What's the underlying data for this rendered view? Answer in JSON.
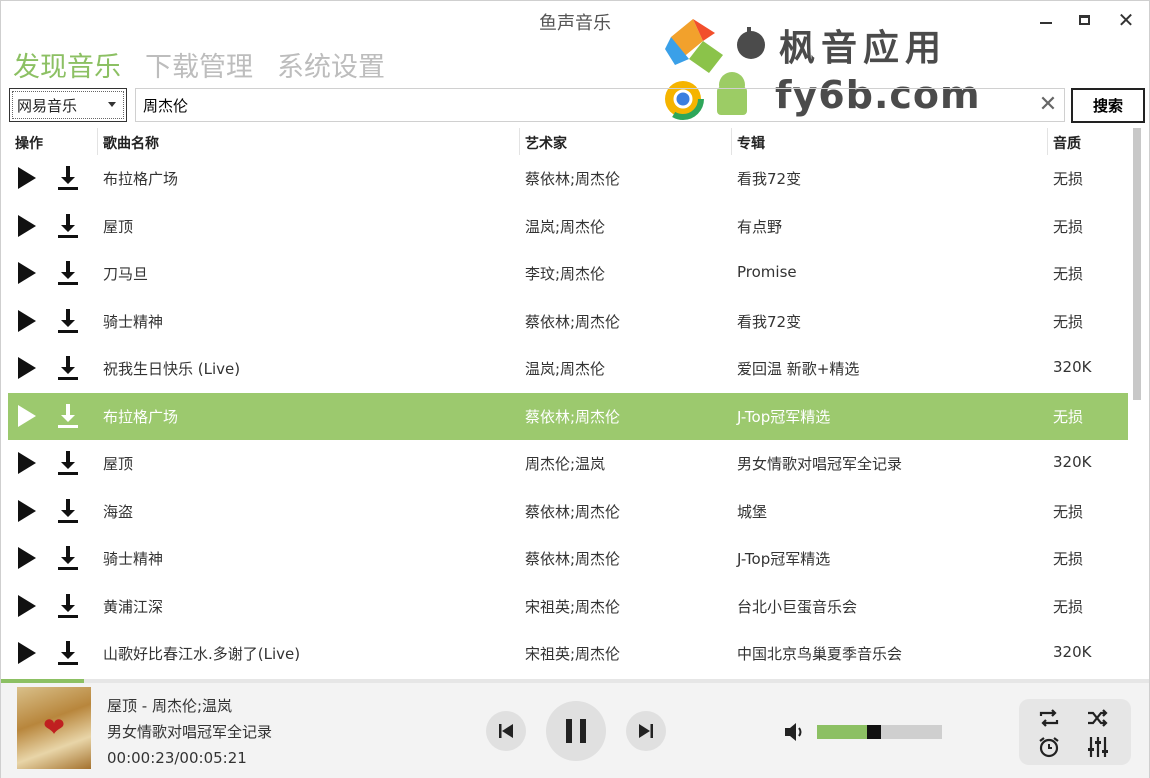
{
  "app": {
    "title": "鱼声音乐"
  },
  "nav": {
    "tabs": [
      {
        "label": "发现音乐",
        "active": true
      },
      {
        "label": "下载管理",
        "active": false
      },
      {
        "label": "系统设置",
        "active": false
      }
    ]
  },
  "watermark": {
    "line1": "枫音应用",
    "line2": "fy6b.com"
  },
  "search": {
    "source": "网易音乐",
    "query": "周杰伦",
    "button_label": "搜索"
  },
  "table": {
    "columns": [
      "操作",
      "歌曲名称",
      "艺术家",
      "专辑",
      "音质"
    ],
    "selected_index": 5,
    "rows": [
      {
        "song": "布拉格广场",
        "artist": "蔡依林;周杰伦",
        "album": "看我72变",
        "quality": "无损"
      },
      {
        "song": "屋顶",
        "artist": "温岚;周杰伦",
        "album": "有点野",
        "quality": "无损"
      },
      {
        "song": "刀马旦",
        "artist": "李玟;周杰伦",
        "album": "Promise",
        "quality": "无损"
      },
      {
        "song": "骑士精神",
        "artist": "蔡依林;周杰伦",
        "album": "看我72变",
        "quality": "无损"
      },
      {
        "song": "祝我生日快乐 (Live)",
        "artist": "温岚;周杰伦",
        "album": "爱回温 新歌+精选",
        "quality": "320K"
      },
      {
        "song": "布拉格广场",
        "artist": "蔡依林;周杰伦",
        "album": "J-Top冠军精选",
        "quality": "无损"
      },
      {
        "song": "屋顶",
        "artist": "周杰伦;温岚",
        "album": "男女情歌对唱冠军全记录",
        "quality": "320K"
      },
      {
        "song": "海盗",
        "artist": "蔡依林;周杰伦",
        "album": "城堡",
        "quality": "无损"
      },
      {
        "song": "骑士精神",
        "artist": "蔡依林;周杰伦",
        "album": "J-Top冠军精选",
        "quality": "无损"
      },
      {
        "song": "黄浦江深",
        "artist": "宋祖英;周杰伦",
        "album": "台北小巨蛋音乐会",
        "quality": "无损"
      },
      {
        "song": "山歌好比春江水.多谢了(Live)",
        "artist": "宋祖英;周杰伦",
        "album": "中国北京鸟巢夏季音乐会",
        "quality": "320K"
      }
    ]
  },
  "player": {
    "now_playing": "屋顶 - 周杰伦;温岚",
    "album": "男女情歌对唱冠军全记录",
    "time": "00:00:23/00:05:21",
    "progress": 0.072,
    "volume": 0.45
  },
  "colors": {
    "accent": "#8cc063",
    "selected_row": "#9cc96e"
  }
}
